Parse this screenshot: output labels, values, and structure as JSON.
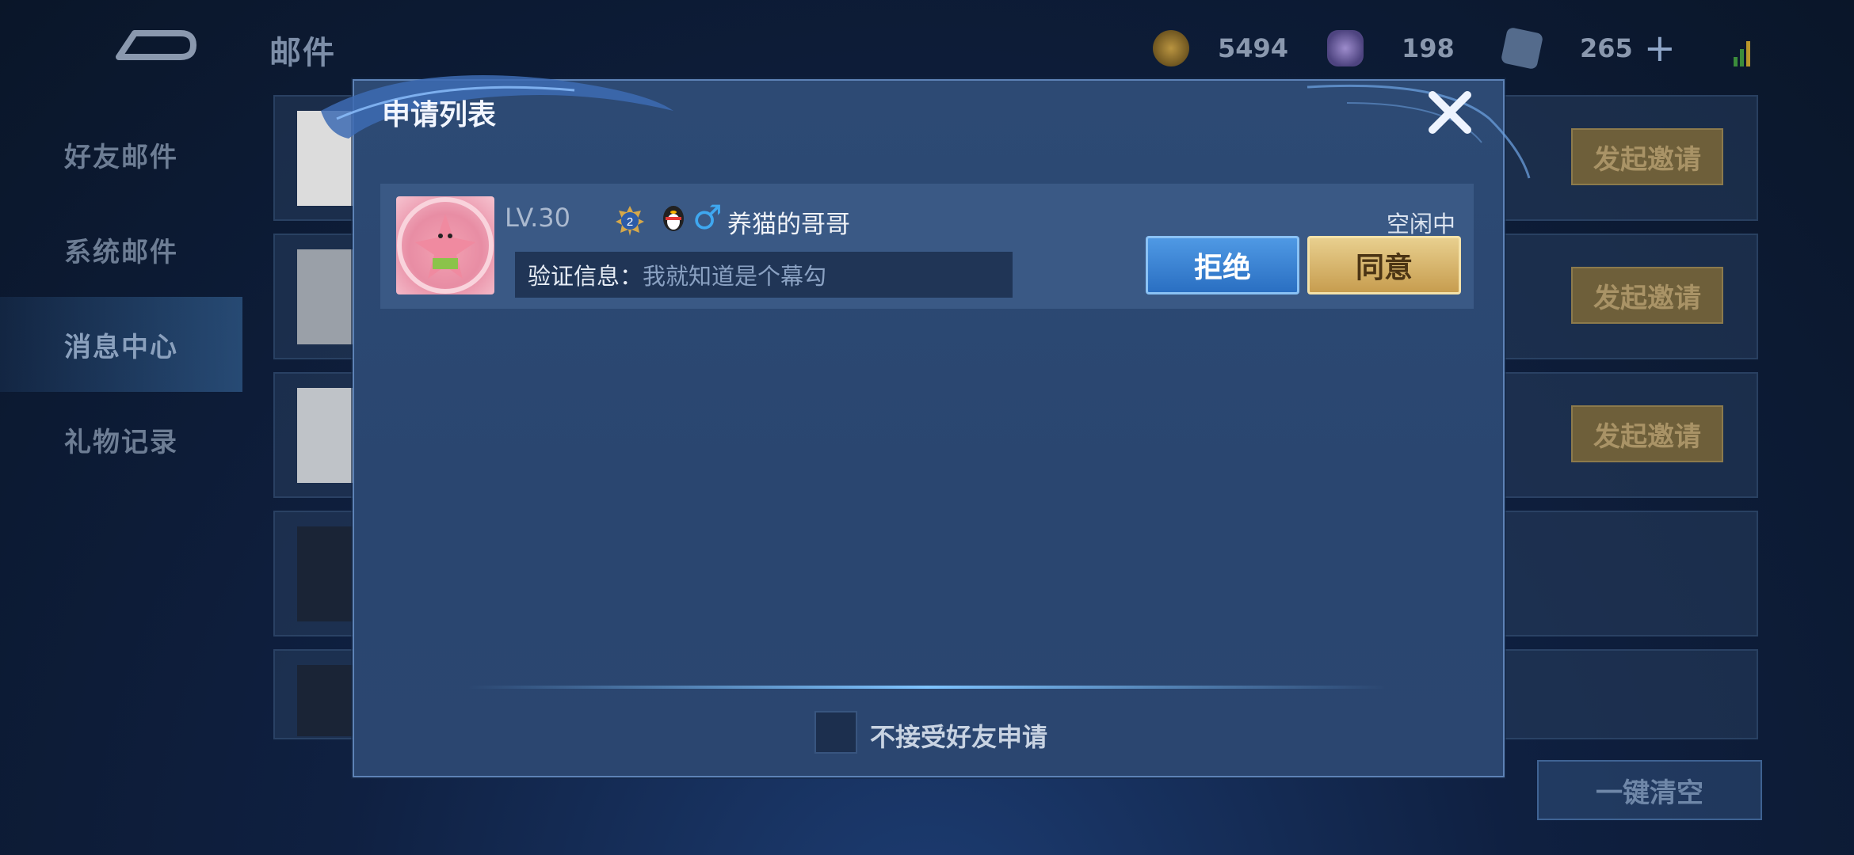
{
  "background": {
    "page_title": "邮件",
    "resources": [
      {
        "icon": "gold-coin-icon",
        "value": "5494"
      },
      {
        "icon": "diamond-icon",
        "value": "198"
      },
      {
        "icon": "voucher-icon",
        "value": "265"
      }
    ],
    "nav": [
      {
        "label": "好友邮件"
      },
      {
        "label": "系统邮件"
      },
      {
        "label": "消息中心",
        "active": true
      },
      {
        "label": "礼物记录"
      }
    ],
    "invite_label": "发起邀请",
    "clear_label": "一键清空"
  },
  "modal": {
    "title": "申请列表",
    "request": {
      "level": "LV.30",
      "rank_badge": "2",
      "name": "养猫的哥哥",
      "status": "空闲中",
      "verify_label": "验证信息：",
      "verify_message": "我就知道是个幕勾",
      "reject_label": "拒绝",
      "accept_label": "同意"
    },
    "decline_all_label": "不接受好友申请"
  },
  "colors": {
    "accent_blue": "#2a6fc2",
    "accent_gold": "#c79d4f",
    "gender_male": "#3fa8f0"
  }
}
